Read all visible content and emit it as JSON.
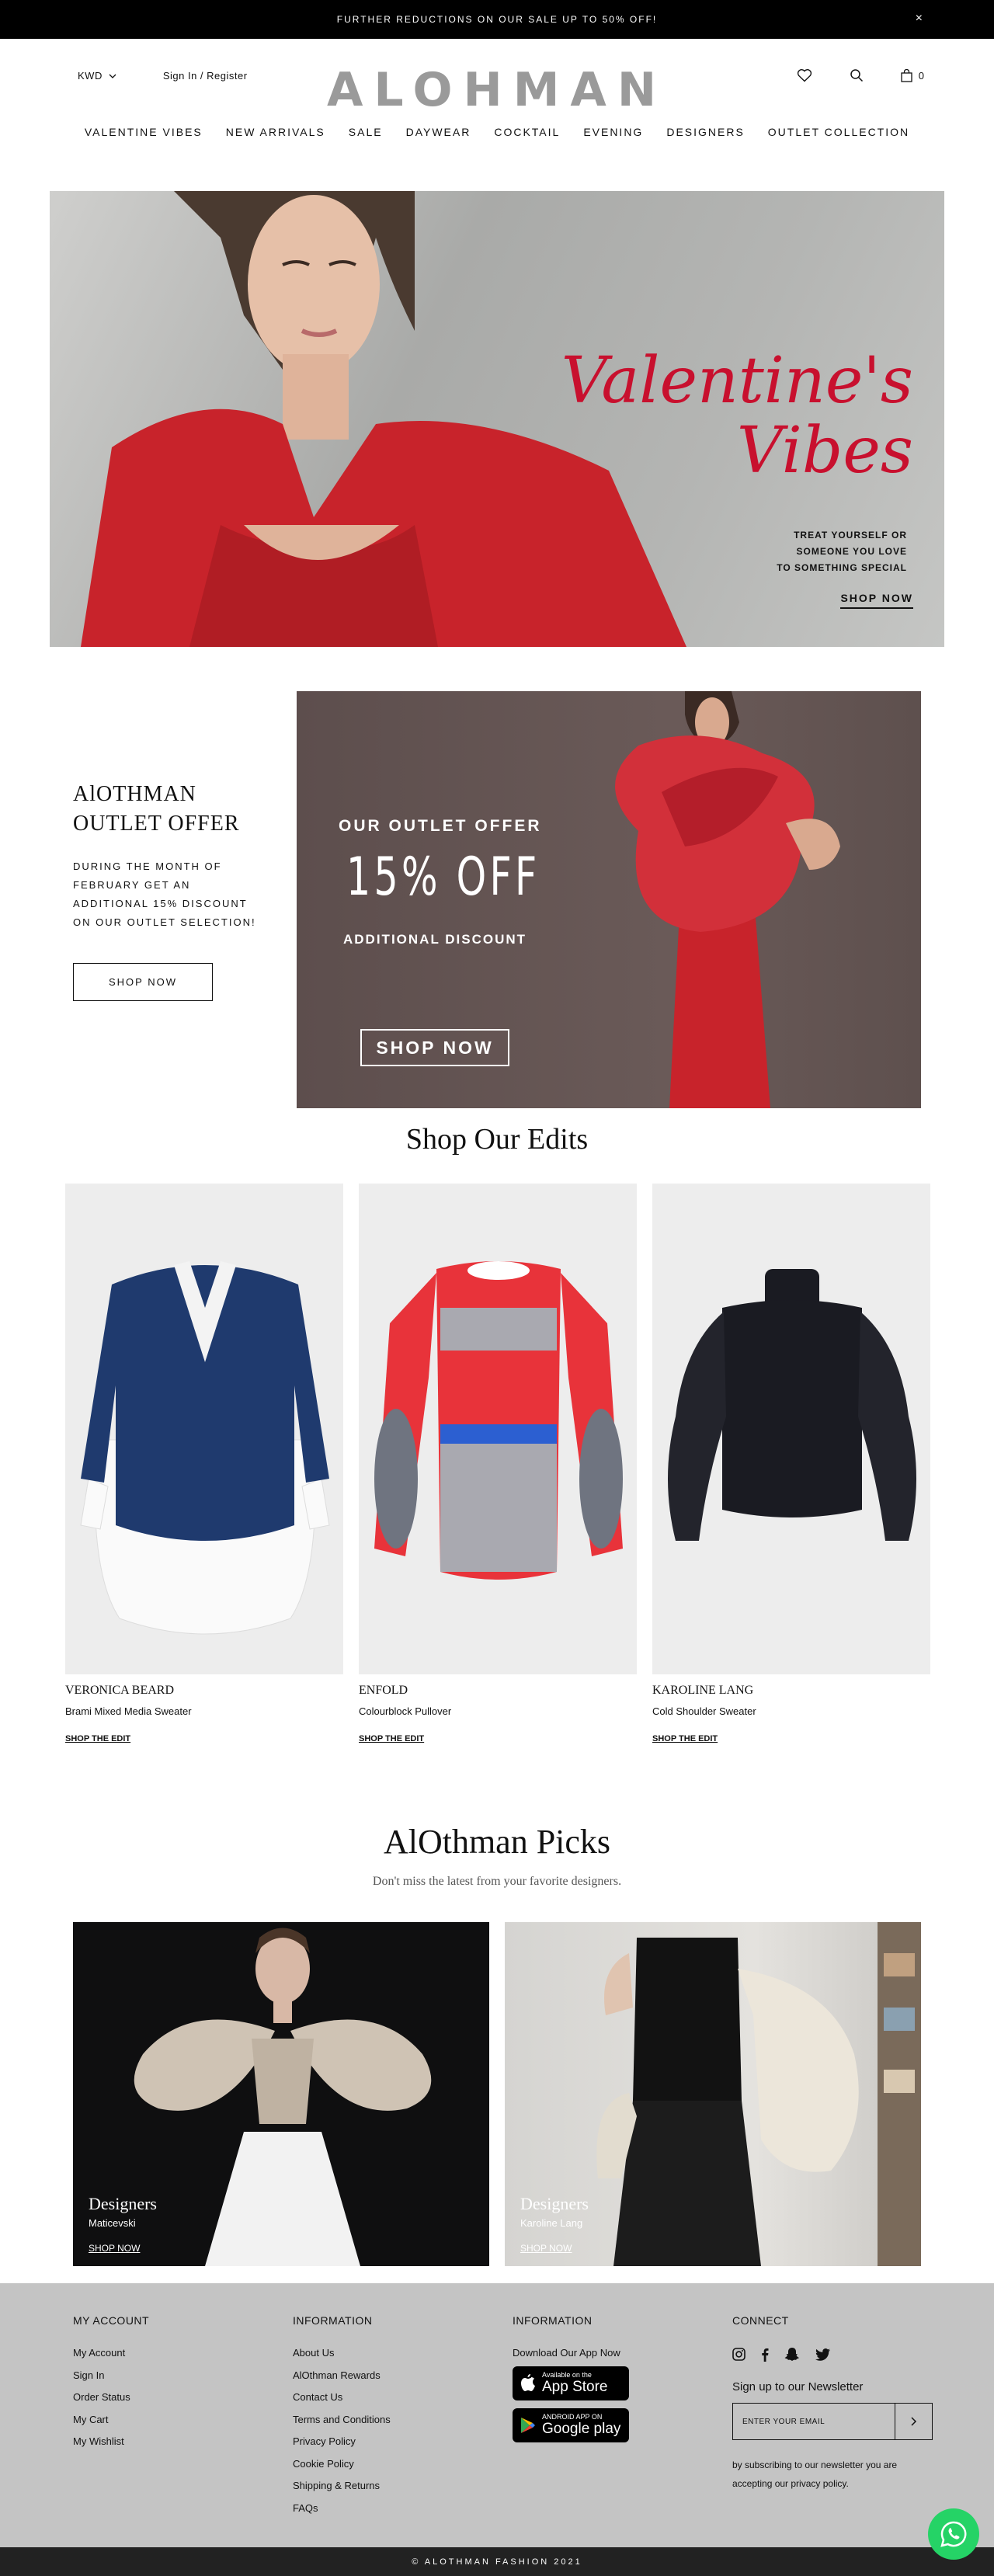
{
  "topbar": {
    "message": "FURTHER REDUCTIONS ON OUR SALE UP TO 50% OFF!",
    "close": "×"
  },
  "header": {
    "currency": "KWD",
    "sign_in": "Sign In / Register",
    "logo": "ALOHMAN",
    "cart_count": "0"
  },
  "nav": [
    "VALENTINE VIBES",
    "NEW ARRIVALS",
    "SALE",
    "DAYWEAR",
    "COCKTAIL",
    "EVENING",
    "DESIGNERS",
    "OUTLET COLLECTION"
  ],
  "hero": {
    "title_line1": "Valentine's",
    "title_line2": "Vibes",
    "tag_line1": "TREAT YOURSELF OR",
    "tag_line2": "SOMEONE YOU LOVE",
    "tag_line3": "TO SOMETHING SPECIAL",
    "cta": "SHOP NOW"
  },
  "outlet": {
    "title_line1": "AlOTHMAN",
    "title_line2": "OUTLET OFFER",
    "desc": "DURING THE MONTH OF FEBRUARY GET AN ADDITIONAL 15% DISCOUNT ON OUR OUTLET SELECTION!",
    "cta": "SHOP NOW",
    "banner_line1": "OUR OUTLET OFFER",
    "banner_line2": "15% OFF",
    "banner_line3": "ADDITIONAL DISCOUNT",
    "banner_cta": "SHOP NOW"
  },
  "edits": {
    "title": "Shop Our Edits",
    "items": [
      {
        "brand": "VERONICA BEARD",
        "name": "Brami Mixed Media Sweater",
        "link": "SHOP THE EDIT"
      },
      {
        "brand": "ENFOLD",
        "name": "Colourblock Pullover",
        "link": "SHOP THE EDIT"
      },
      {
        "brand": "KAROLINE LANG",
        "name": "Cold Shoulder Sweater",
        "link": "SHOP THE EDIT"
      }
    ]
  },
  "picks": {
    "title": "AlOthman Picks",
    "subtitle": "Don't miss the latest from your favorite designers.",
    "items": [
      {
        "label": "Designers",
        "name": "Maticevski",
        "link": "SHOP NOW"
      },
      {
        "label": "Designers",
        "name": "Karoline Lang",
        "link": "SHOP NOW"
      }
    ]
  },
  "footer": {
    "account": {
      "title": "MY ACCOUNT",
      "links": [
        "My Account",
        "Sign In",
        "Order Status",
        "My Cart",
        "My Wishlist"
      ]
    },
    "information": {
      "title": "INFORMATION",
      "links": [
        "About Us",
        "AlOthman Rewards",
        "Contact Us",
        "Terms and Conditions",
        "Privacy Policy",
        "Cookie Policy",
        "Shipping & Returns",
        "FAQs"
      ]
    },
    "app": {
      "title": "INFORMATION",
      "download": "Download Our App Now",
      "appstore_small": "Available on the",
      "appstore_big": "App Store",
      "gplay_small": "ANDROID APP ON",
      "gplay_big": "Google play"
    },
    "connect": {
      "title": "CONNECT",
      "newsletter_title": "Sign up to our Newsletter",
      "placeholder": "ENTER YOUR EMAIL",
      "note": "by subscribing to our newsletter you are accepting our privacy policy."
    },
    "copyright": "© ALOTHMAN FASHION 2021"
  },
  "colors": {
    "accent": "#c8102e",
    "footer_bg": "#c4c4c4",
    "whatsapp": "#25d366"
  }
}
